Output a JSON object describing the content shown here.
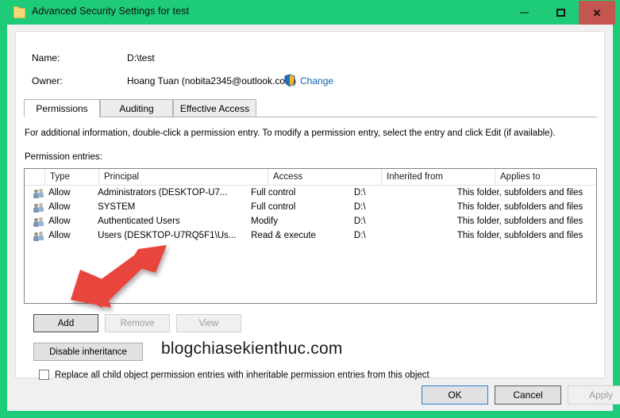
{
  "window": {
    "title": "Advanced Security Settings for test",
    "icon": "folder-icon",
    "accent_color": "#1ecb79",
    "close_color": "#c4564f",
    "controls": {
      "minimize": "–",
      "maximize": "☐",
      "close": "✕"
    }
  },
  "header": {
    "name_label": "Name:",
    "name_value": "D:\\test",
    "owner_label": "Owner:",
    "owner_value": "Hoang Tuan (nobita2345@outlook.com)",
    "change_link": "Change",
    "shield_icon": "uac-shield-icon"
  },
  "tabs": [
    {
      "label": "Permissions",
      "active": true
    },
    {
      "label": "Auditing",
      "active": false
    },
    {
      "label": "Effective Access",
      "active": false
    }
  ],
  "body": {
    "info_text": "For additional information, double-click a permission entry. To modify a permission entry, select the entry and click Edit (if available).",
    "entries_label": "Permission entries:"
  },
  "table": {
    "columns": [
      "",
      "Type",
      "Principal",
      "Access",
      "Inherited from",
      "Applies to"
    ],
    "rows": [
      {
        "icon": "users-icon",
        "type": "Allow",
        "principal": "Administrators (DESKTOP-U7...",
        "access": "Full control",
        "inherited_from": "D:\\",
        "applies_to": "This folder, subfolders and files"
      },
      {
        "icon": "users-icon",
        "type": "Allow",
        "principal": "SYSTEM",
        "access": "Full control",
        "inherited_from": "D:\\",
        "applies_to": "This folder, subfolders and files"
      },
      {
        "icon": "users-icon",
        "type": "Allow",
        "principal": "Authenticated Users",
        "access": "Modify",
        "inherited_from": "D:\\",
        "applies_to": "This folder, subfolders and files"
      },
      {
        "icon": "users-icon",
        "type": "Allow",
        "principal": "Users (DESKTOP-U7RQ5F1\\Us...",
        "access": "Read & execute",
        "inherited_from": "D:\\",
        "applies_to": "This folder, subfolders and files"
      }
    ]
  },
  "actions": {
    "add": "Add",
    "remove": "Remove",
    "view": "View",
    "disable_inheritance": "Disable inheritance"
  },
  "watermark": "blogchiasekienthuc.com",
  "checkbox": {
    "label": "Replace all child object permission entries with inheritable permission entries from this object",
    "checked": false
  },
  "footer": {
    "ok": "OK",
    "cancel": "Cancel",
    "apply": "Apply"
  },
  "annotation": {
    "type": "red-arrow",
    "color": "#e8453c",
    "points_to": "add-button"
  }
}
